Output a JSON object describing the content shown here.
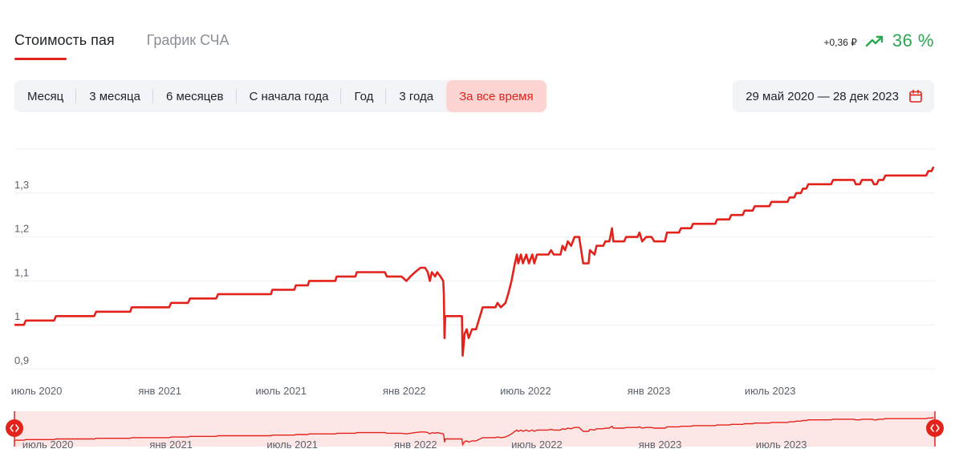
{
  "tabs": [
    {
      "label": "Стоимость пая",
      "active": true
    },
    {
      "label": "График СЧА",
      "active": false
    }
  ],
  "change": {
    "absolute": "+0,36 ₽",
    "percent": "36 %",
    "color": "#2aa650",
    "icon": "trending-up-icon"
  },
  "periods": [
    {
      "label": "Месяц"
    },
    {
      "label": "3 месяца"
    },
    {
      "label": "6 месяцев"
    },
    {
      "label": "С начала года"
    },
    {
      "label": "Год"
    },
    {
      "label": "3 года"
    },
    {
      "label": "За все время",
      "active": true
    }
  ],
  "date_range": {
    "label": "29 май 2020 — 28 дек 2023",
    "icon": "calendar-icon"
  },
  "colors": {
    "accent": "#e3231b",
    "navigator_fill": "#fde7e6"
  },
  "chart_data": {
    "type": "line",
    "series": [
      {
        "color": "#e3231b",
        "points": [
          [
            "2020-05-29",
            1.0
          ],
          [
            "2020-06-12",
            1.0
          ],
          [
            "2020-06-15",
            1.01
          ],
          [
            "2020-07-27",
            1.01
          ],
          [
            "2020-07-30",
            1.02
          ],
          [
            "2020-09-25",
            1.02
          ],
          [
            "2020-09-28",
            1.03
          ],
          [
            "2020-11-18",
            1.03
          ],
          [
            "2020-11-20",
            1.04
          ],
          [
            "2021-01-15",
            1.04
          ],
          [
            "2021-01-18",
            1.05
          ],
          [
            "2021-02-12",
            1.05
          ],
          [
            "2021-02-15",
            1.06
          ],
          [
            "2021-03-26",
            1.06
          ],
          [
            "2021-03-29",
            1.07
          ],
          [
            "2021-06-16",
            1.07
          ],
          [
            "2021-06-18",
            1.08
          ],
          [
            "2021-07-21",
            1.08
          ],
          [
            "2021-07-23",
            1.09
          ],
          [
            "2021-08-10",
            1.09
          ],
          [
            "2021-08-12",
            1.1
          ],
          [
            "2021-09-20",
            1.1
          ],
          [
            "2021-09-22",
            1.11
          ],
          [
            "2021-10-20",
            1.11
          ],
          [
            "2021-10-22",
            1.12
          ],
          [
            "2021-12-03",
            1.12
          ],
          [
            "2021-12-06",
            1.11
          ],
          [
            "2021-12-28",
            1.11
          ],
          [
            "2022-01-04",
            1.1
          ],
          [
            "2022-01-10",
            1.11
          ],
          [
            "2022-01-17",
            1.12
          ],
          [
            "2022-01-25",
            1.13
          ],
          [
            "2022-02-01",
            1.13
          ],
          [
            "2022-02-05",
            1.12
          ],
          [
            "2022-02-08",
            1.1
          ],
          [
            "2022-02-11",
            1.12
          ],
          [
            "2022-02-16",
            1.11
          ],
          [
            "2022-02-19",
            1.12
          ],
          [
            "2022-02-24",
            1.11
          ],
          [
            "2022-02-28",
            1.1
          ],
          [
            "2022-03-01",
            1.07
          ],
          [
            "2022-03-02",
            0.97
          ],
          [
            "2022-03-03",
            1.02
          ],
          [
            "2022-03-28",
            1.02
          ],
          [
            "2022-03-29",
            0.93
          ],
          [
            "2022-04-01",
            0.98
          ],
          [
            "2022-04-04",
            0.99
          ],
          [
            "2022-04-07",
            0.97
          ],
          [
            "2022-04-12",
            0.99
          ],
          [
            "2022-04-18",
            0.99
          ],
          [
            "2022-04-22",
            1.01
          ],
          [
            "2022-04-28",
            1.04
          ],
          [
            "2022-05-17",
            1.04
          ],
          [
            "2022-05-20",
            1.05
          ],
          [
            "2022-05-25",
            1.04
          ],
          [
            "2022-06-01",
            1.05
          ],
          [
            "2022-06-05",
            1.07
          ],
          [
            "2022-06-10",
            1.1
          ],
          [
            "2022-06-15",
            1.14
          ],
          [
            "2022-06-18",
            1.16
          ],
          [
            "2022-06-20",
            1.14
          ],
          [
            "2022-06-24",
            1.16
          ],
          [
            "2022-06-27",
            1.14
          ],
          [
            "2022-07-02",
            1.16
          ],
          [
            "2022-07-06",
            1.14
          ],
          [
            "2022-07-11",
            1.16
          ],
          [
            "2022-07-14",
            1.14
          ],
          [
            "2022-07-18",
            1.16
          ],
          [
            "2022-08-04",
            1.16
          ],
          [
            "2022-08-08",
            1.17
          ],
          [
            "2022-08-12",
            1.16
          ],
          [
            "2022-08-22",
            1.16
          ],
          [
            "2022-08-25",
            1.18
          ],
          [
            "2022-08-29",
            1.17
          ],
          [
            "2022-09-02",
            1.19
          ],
          [
            "2022-09-07",
            1.18
          ],
          [
            "2022-09-12",
            1.2
          ],
          [
            "2022-09-19",
            1.2
          ],
          [
            "2022-09-22",
            1.17
          ],
          [
            "2022-09-25",
            1.14
          ],
          [
            "2022-10-03",
            1.14
          ],
          [
            "2022-10-05",
            1.17
          ],
          [
            "2022-10-12",
            1.16
          ],
          [
            "2022-10-15",
            1.18
          ],
          [
            "2022-10-25",
            1.18
          ],
          [
            "2022-10-28",
            1.19
          ],
          [
            "2022-11-03",
            1.19
          ],
          [
            "2022-11-07",
            1.22
          ],
          [
            "2022-11-09",
            1.19
          ],
          [
            "2022-11-25",
            1.19
          ],
          [
            "2022-11-28",
            1.2
          ],
          [
            "2022-12-15",
            1.2
          ],
          [
            "2022-12-18",
            1.21
          ],
          [
            "2022-12-22",
            1.19
          ],
          [
            "2022-12-28",
            1.2
          ],
          [
            "2023-01-05",
            1.2
          ],
          [
            "2023-01-09",
            1.19
          ],
          [
            "2023-01-25",
            1.19
          ],
          [
            "2023-01-28",
            1.21
          ],
          [
            "2023-02-15",
            1.21
          ],
          [
            "2023-02-18",
            1.22
          ],
          [
            "2023-03-05",
            1.22
          ],
          [
            "2023-03-08",
            1.23
          ],
          [
            "2023-04-10",
            1.23
          ],
          [
            "2023-04-13",
            1.24
          ],
          [
            "2023-05-01",
            1.24
          ],
          [
            "2023-05-04",
            1.25
          ],
          [
            "2023-05-21",
            1.25
          ],
          [
            "2023-05-24",
            1.26
          ],
          [
            "2023-06-05",
            1.26
          ],
          [
            "2023-06-08",
            1.27
          ],
          [
            "2023-06-30",
            1.27
          ],
          [
            "2023-07-03",
            1.28
          ],
          [
            "2023-07-27",
            1.28
          ],
          [
            "2023-07-30",
            1.29
          ],
          [
            "2023-08-06",
            1.29
          ],
          [
            "2023-08-09",
            1.3
          ],
          [
            "2023-08-16",
            1.3
          ],
          [
            "2023-08-19",
            1.31
          ],
          [
            "2023-08-24",
            1.31
          ],
          [
            "2023-08-27",
            1.32
          ],
          [
            "2023-09-30",
            1.32
          ],
          [
            "2023-10-03",
            1.33
          ],
          [
            "2023-11-03",
            1.33
          ],
          [
            "2023-11-06",
            1.32
          ],
          [
            "2023-11-12",
            1.32
          ],
          [
            "2023-11-15",
            1.33
          ],
          [
            "2023-11-30",
            1.33
          ],
          [
            "2023-12-03",
            1.32
          ],
          [
            "2023-12-07",
            1.32
          ],
          [
            "2023-12-10",
            1.33
          ],
          [
            "2023-12-17",
            1.33
          ],
          [
            "2023-12-20",
            1.34
          ],
          [
            "2024-02-19",
            1.34
          ],
          [
            "2024-02-22",
            1.35
          ],
          [
            "2024-02-27",
            1.35
          ],
          [
            "2024-03-01",
            1.36
          ]
        ]
      }
    ],
    "y_ticks": [
      0.9,
      1,
      1.1,
      1.2,
      1.3
    ],
    "y_tick_labels": [
      "0,9",
      "1",
      "1,1",
      "1,2",
      "1,3"
    ],
    "ylim": [
      0.88,
      1.4
    ],
    "xlim": [
      "2020-05-29",
      "2024-03-03"
    ],
    "x_ticks": [
      {
        "date": "2020-07-01",
        "label": "июль 2020"
      },
      {
        "date": "2021-01-01",
        "label": "янв 2021"
      },
      {
        "date": "2021-07-01",
        "label": "июль 2021"
      },
      {
        "date": "2022-01-01",
        "label": "янв 2022"
      },
      {
        "date": "2022-07-01",
        "label": "июль 2022"
      },
      {
        "date": "2023-01-01",
        "label": "янв 2023"
      },
      {
        "date": "2023-07-01",
        "label": "июль 2023"
      }
    ],
    "grid": true,
    "navigator": {
      "x_ticks": [
        {
          "date": "2020-07-01",
          "label": "июль 2020"
        },
        {
          "date": "2021-01-01",
          "label": "янв 2021"
        },
        {
          "date": "2021-07-01",
          "label": "июль 2021"
        },
        {
          "date": "2022-01-01",
          "label": "янв 2022"
        },
        {
          "date": "2022-07-01",
          "label": "июль 2022"
        },
        {
          "date": "2023-01-01",
          "label": "янв 2023"
        },
        {
          "date": "2023-07-01",
          "label": "июль 2023"
        }
      ],
      "handle_icon": "drag-handle-icon"
    }
  }
}
